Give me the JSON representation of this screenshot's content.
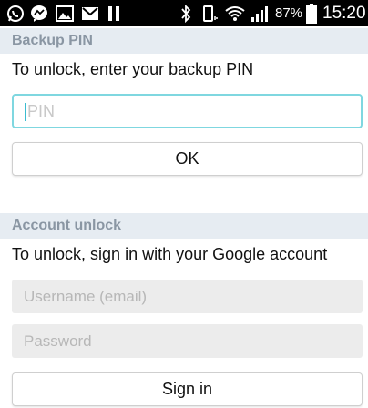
{
  "status_bar": {
    "battery_percent": "87%",
    "time": "15:20",
    "icons": [
      "whatsapp-icon",
      "messenger-icon",
      "gallery-icon",
      "email-icon",
      "pause-icon",
      "bluetooth-icon",
      "vibrate-icon",
      "wifi-icon",
      "signal-icon",
      "battery-icon"
    ]
  },
  "backup_pin": {
    "header": "Backup PIN",
    "instruction": "To unlock, enter your backup PIN",
    "pin_placeholder": "PIN",
    "ok_label": "OK"
  },
  "account_unlock": {
    "header": "Account unlock",
    "instruction": "To unlock, sign in with your Google account",
    "username_placeholder": "Username (email)",
    "password_placeholder": "Password",
    "signin_label": "Sign in"
  },
  "colors": {
    "status_bar": "#000000",
    "header_bg": "#e6ecf2",
    "header_text": "#8a96a3",
    "focus_border": "#7fd7e0"
  }
}
